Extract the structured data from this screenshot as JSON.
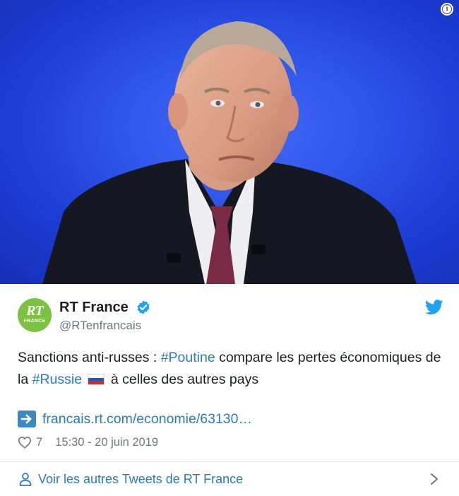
{
  "tweet": {
    "author": {
      "display_name": "RT France",
      "handle": "@RTenfrancais",
      "avatar_text_top": "RT",
      "avatar_text_bottom": "FRANCE",
      "verified": true
    },
    "text_parts": {
      "p1": "Sanctions anti-russes : ",
      "tag1": "#Poutine",
      "p2": " compare les pertes économiques de la ",
      "tag2": "#Russie",
      "p3": " à celles des autres pays"
    },
    "link_text": "francais.rt.com/economie/63130…",
    "likes": "7",
    "timestamp": "15:30 - 20 juin 2019",
    "footer_link": "Voir les autres Tweets de RT France"
  },
  "icons": {
    "info": "info-icon",
    "verified": "verified-badge-icon",
    "twitter": "twitter-bird-icon",
    "flag": "russia-flag-icon",
    "link": "arrow-right-icon",
    "like": "heart-icon",
    "profile": "person-icon",
    "chevron": "chevron-right-icon"
  },
  "colors": {
    "link": "#2b7bb9",
    "text": "#1c2022",
    "muted": "#697882",
    "avatar_bg": "#7cc242",
    "photo_bg": "#2a4fe6",
    "twitter_blue": "#1da1f2"
  }
}
